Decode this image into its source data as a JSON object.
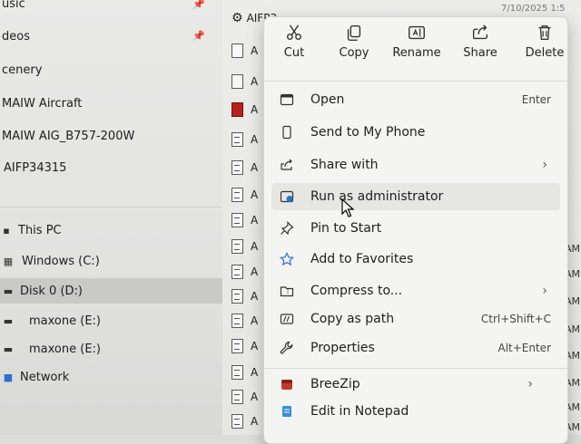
{
  "nav": {
    "items": [
      {
        "label": "usic",
        "top": 0
      },
      {
        "label": "deos",
        "top": 0
      },
      {
        "label": "cenery",
        "top": 0
      },
      {
        "label": "MAIW Aircraft",
        "top": 0
      },
      {
        "label": "MAIW AIG_B757-200W",
        "top": 0
      },
      {
        "label": "AIFP34315",
        "top": 0
      }
    ],
    "this_pc": "This PC",
    "drives": [
      "Windows (C:)",
      "Disk 0 (D:)",
      "maxone (E:)",
      "maxone (E:)"
    ],
    "network": "Network"
  },
  "file_pane": {
    "header_name": "AIFP3",
    "header_date": "7/10/2025 1:5",
    "row_letter": "A",
    "right_col_labels": [
      "AM",
      "AM",
      "AM",
      "AM",
      "AM",
      "AM",
      "AM",
      "AM"
    ]
  },
  "context_menu": {
    "actions": [
      {
        "label": "Cut",
        "icon": "scissors-icon"
      },
      {
        "label": "Copy",
        "icon": "copy-icon"
      },
      {
        "label": "Rename",
        "icon": "rename-icon"
      },
      {
        "label": "Share",
        "icon": "share-icon"
      },
      {
        "label": "Delete",
        "icon": "trash-icon"
      }
    ],
    "items": [
      {
        "label": "Open",
        "shortcut": "Enter",
        "icon": "open-icon"
      },
      {
        "label": "Send to My Phone",
        "shortcut": "",
        "icon": "phone-icon"
      },
      {
        "label": "Share with",
        "shortcut": "",
        "icon": "share-with-icon",
        "submenu": true
      },
      {
        "label": "Run as administrator",
        "shortcut": "",
        "icon": "shield-admin-icon"
      },
      {
        "label": "Pin to Start",
        "shortcut": "",
        "icon": "pin-icon"
      },
      {
        "label": "Add to Favorites",
        "shortcut": "",
        "icon": "star-icon"
      },
      {
        "label": "Compress to...",
        "shortcut": "",
        "icon": "zip-folder-icon",
        "submenu": true
      },
      {
        "label": "Copy as path",
        "shortcut": "Ctrl+Shift+C",
        "icon": "path-icon"
      },
      {
        "label": "Properties",
        "shortcut": "Alt+Enter",
        "icon": "wrench-icon"
      },
      {
        "label": "BreeZip",
        "shortcut": "",
        "icon": "breezip-icon",
        "submenu": true
      },
      {
        "label": "Edit in Notepad",
        "shortcut": "",
        "icon": "notepad-icon"
      }
    ],
    "chevron": "›"
  },
  "colors": {
    "accent": "#2f6fcf",
    "menu_bg": "#f4f4f2",
    "hover": "#e6e6e3"
  }
}
